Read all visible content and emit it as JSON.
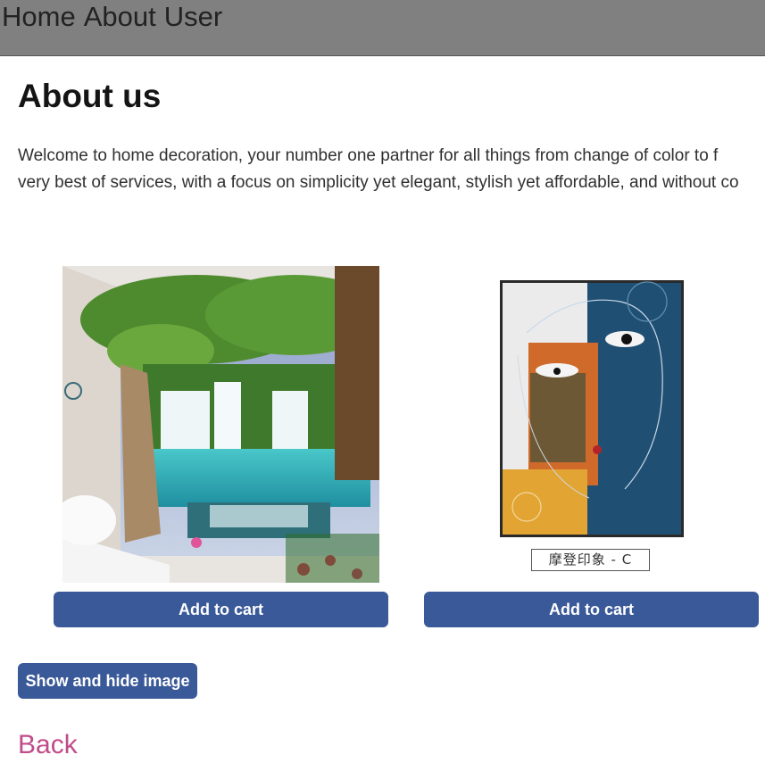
{
  "nav": {
    "items": [
      "Home",
      "About",
      "User"
    ]
  },
  "page": {
    "title": "About us",
    "intro_line1": "Welcome to home decoration, your number one partner for all things from change of color to f",
    "intro_line2": "very best of services, with a focus on simplicity yet elegant, stylish yet affordable, and without co"
  },
  "products": [
    {
      "image_icon": "waterfall-wall-mural-image",
      "cart_label": "Add to cart"
    },
    {
      "image_icon": "abstract-face-painting-image",
      "caption": "摩登印象 - C",
      "cart_label": "Add to cart"
    }
  ],
  "actions": {
    "toggle_label": "Show and hide image",
    "back_label": "Back"
  },
  "colors": {
    "topbar": "#808080",
    "button": "#3a5998",
    "link": "#c04c8a"
  }
}
